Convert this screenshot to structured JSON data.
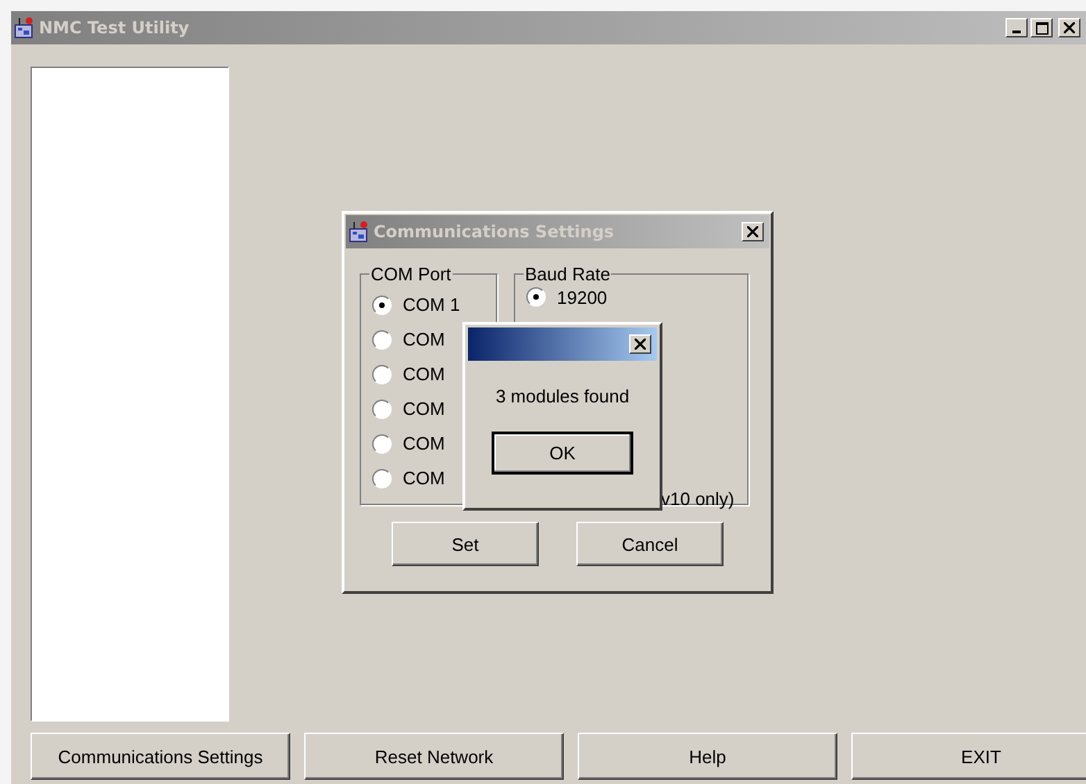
{
  "window": {
    "title": "NMC Test Utility"
  },
  "buttons": [
    "Communications Settings",
    "Reset Network",
    "Help",
    "EXIT"
  ],
  "dialog": {
    "title": "Communications Settings",
    "com_port": {
      "label": "COM Port",
      "options": [
        {
          "label": "COM 1",
          "selected": true
        },
        {
          "label": "COM",
          "selected": false
        },
        {
          "label": "COM",
          "selected": false
        },
        {
          "label": "COM",
          "selected": false
        },
        {
          "label": "COM",
          "selected": false
        },
        {
          "label": "COM",
          "selected": false
        }
      ]
    },
    "baud_rate": {
      "label": "Baud Rate",
      "options": [
        {
          "label": "19200",
          "selected": true
        }
      ],
      "note": "v10 only)"
    },
    "buttons": [
      "Set",
      "Cancel"
    ]
  },
  "message_box": {
    "message": "3 modules found",
    "buttons": [
      "OK"
    ]
  }
}
